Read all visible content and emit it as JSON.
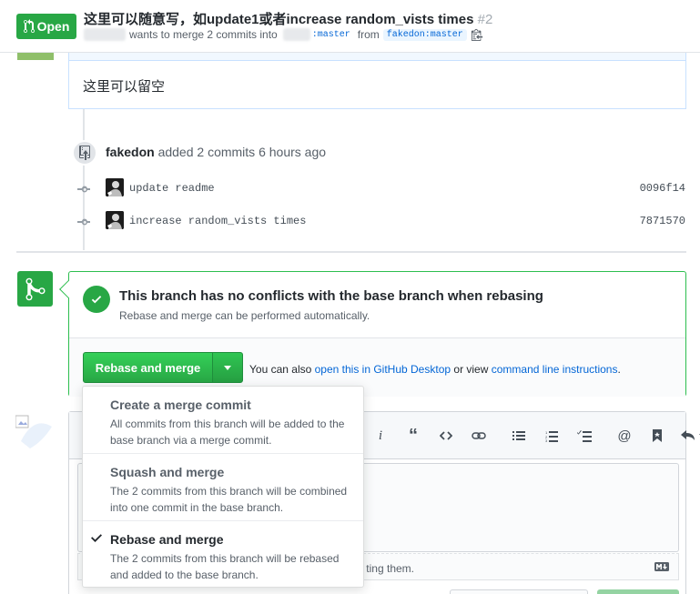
{
  "header": {
    "state": "Open",
    "title": "这里可以随意写，如update1或者increase random_vists times",
    "number": "#2",
    "meta_wants": "wants to merge 2 commits into",
    "base_branch": ":master",
    "meta_from": "from",
    "head_branch": "fakedon:master"
  },
  "comment": {
    "body": "这里可以留空"
  },
  "timeline": {
    "actor": "fakedon",
    "event": "added 2 commits 6 hours ago",
    "commits": [
      {
        "message": "update readme",
        "sha": "0096f14"
      },
      {
        "message": "increase random_vists times",
        "sha": "7871570"
      }
    ]
  },
  "merge": {
    "title": "This branch has no conflicts with the base branch when rebasing",
    "subtitle": "Rebase and merge can be performed automatically.",
    "button_label": "Rebase and merge",
    "hint_prefix": "You can also",
    "hint_link1": "open this in GitHub Desktop",
    "hint_mid": "or view",
    "hint_link2": "command line instructions",
    "hint_suffix": "."
  },
  "menu": {
    "items": [
      {
        "title": "Create a merge commit",
        "description": "All commits from this branch will be added to the base branch via a merge commit.",
        "selected": false
      },
      {
        "title": "Squash and merge",
        "description": "The 2 commits from this branch will be combined into one commit in the base branch.",
        "selected": false
      },
      {
        "title": "Rebase and merge",
        "description": "The 2 commits from this branch will be rebased and added to the base branch.",
        "selected": true
      }
    ]
  },
  "form": {
    "drop_hint_tail": "ting them."
  },
  "colors": {
    "green": "#28a745",
    "link": "#0366d6",
    "border_green": "#2cbe4e"
  }
}
